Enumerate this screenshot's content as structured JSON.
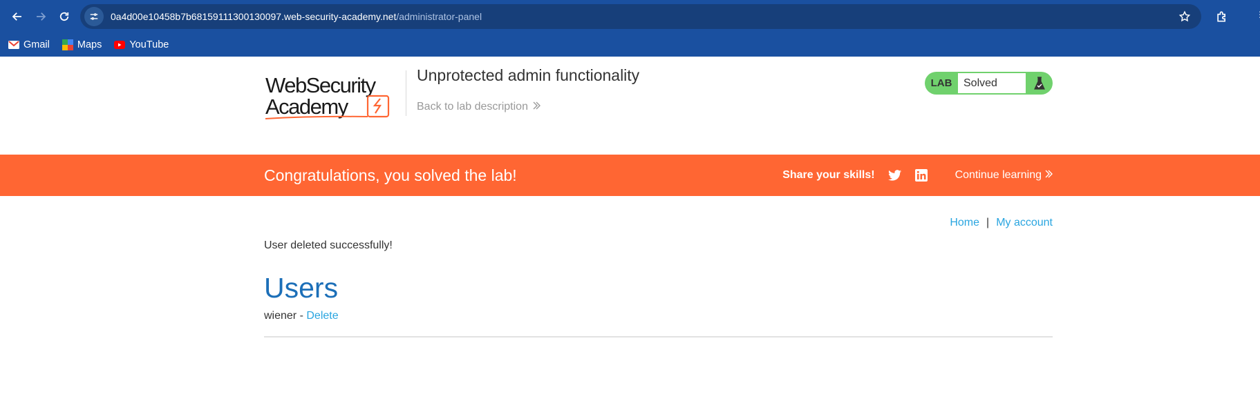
{
  "browser": {
    "url_host": "0a4d00e10458b7b68159111300130097.web-security-academy.net",
    "url_path": "/administrator-panel",
    "bookmarks": [
      {
        "label": "Gmail",
        "icon": "gmail-icon"
      },
      {
        "label": "Maps",
        "icon": "maps-icon"
      },
      {
        "label": "YouTube",
        "icon": "youtube-icon"
      }
    ]
  },
  "header": {
    "logo_line1": "WebSecurity",
    "logo_line2": "Academy",
    "lab_title": "Unprotected admin functionality",
    "back_link": "Back to lab description",
    "status_tag": "LAB",
    "status_text": "Solved"
  },
  "banner": {
    "message": "Congratulations, you solved the lab!",
    "share_label": "Share your skills!",
    "continue_label": "Continue learning"
  },
  "nav": {
    "home": "Home",
    "separator": "|",
    "my_account": "My account"
  },
  "main": {
    "message": "User deleted successfully!",
    "users_heading": "Users",
    "users": [
      {
        "name": "wiener",
        "separator": " - ",
        "action": "Delete"
      }
    ]
  },
  "colors": {
    "chrome": "#1a50a0",
    "banner": "#ff6633",
    "solved_badge": "#70d16d",
    "link": "#29a5e0",
    "heading": "#1c6fb8"
  }
}
